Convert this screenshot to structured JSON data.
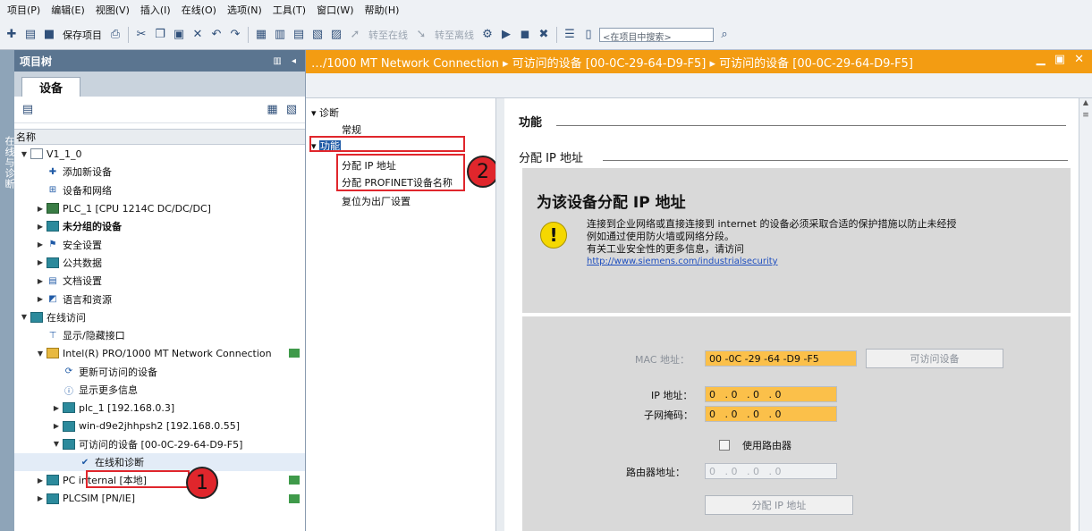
{
  "menu": [
    "项目(P)",
    "编辑(E)",
    "视图(V)",
    "插入(I)",
    "在线(O)",
    "选项(N)",
    "工具(T)",
    "窗口(W)",
    "帮助(H)"
  ],
  "toolbar": {
    "save_label": "保存项目",
    "go_online": "转至在线",
    "go_offline": "转至离线",
    "search_placeholder": "<在项目中搜索>"
  },
  "side_strip_label": "在线与诊断",
  "tree": {
    "title": "项目树",
    "tab": "设备",
    "column_header": "名称",
    "items": [
      {
        "label": "V1_1_0",
        "indent": 0,
        "arrow": "down",
        "icon": "page"
      },
      {
        "label": "添加新设备",
        "indent": 1,
        "arrow": "",
        "icon": "add-device"
      },
      {
        "label": "设备和网络",
        "indent": 1,
        "arrow": "",
        "icon": "network"
      },
      {
        "label": "PLC_1 [CPU 1214C DC/DC/DC]",
        "indent": 1,
        "arrow": "right",
        "icon": "plc"
      },
      {
        "label": "未分组的设备",
        "indent": 1,
        "arrow": "right",
        "icon": "folder",
        "bold": true
      },
      {
        "label": "安全设置",
        "indent": 1,
        "arrow": "right",
        "icon": "security"
      },
      {
        "label": "公共数据",
        "indent": 1,
        "arrow": "right",
        "icon": "folder"
      },
      {
        "label": "文档设置",
        "indent": 1,
        "arrow": "right",
        "icon": "doc"
      },
      {
        "label": "语言和资源",
        "indent": 1,
        "arrow": "right",
        "icon": "language"
      },
      {
        "label": "在线访问",
        "indent": 0,
        "arrow": "down",
        "icon": "folder"
      },
      {
        "label": "显示/隐藏接口",
        "indent": 1,
        "arrow": "",
        "icon": "filter"
      },
      {
        "label": "Intel(R) PRO/1000 MT Network Connection",
        "indent": 1,
        "arrow": "down",
        "icon": "net"
      },
      {
        "label": "更新可访问的设备",
        "indent": 2,
        "arrow": "",
        "icon": "update"
      },
      {
        "label": "显示更多信息",
        "indent": 2,
        "arrow": "",
        "icon": "info"
      },
      {
        "label": "plc_1 [192.168.0.3]",
        "indent": 2,
        "arrow": "right",
        "icon": "folder"
      },
      {
        "label": "win-d9e2jhhpsh2 [192.168.0.55]",
        "indent": 2,
        "arrow": "right",
        "icon": "folder"
      },
      {
        "label": "可访问的设备 [00-0C-29-64-D9-F5]",
        "indent": 2,
        "arrow": "down",
        "icon": "folder"
      },
      {
        "label": "在线和诊断",
        "indent": 3,
        "arrow": "",
        "icon": "diag"
      },
      {
        "label": "PC internal [本地]",
        "indent": 1,
        "arrow": "right",
        "icon": "folder"
      },
      {
        "label": "PLCSIM [PN/IE]",
        "indent": 1,
        "arrow": "right",
        "icon": "folder"
      }
    ]
  },
  "breadcrumb": "…/1000 MT Network Connection  ▸  可访问的设备 [00-0C-29-64-D9-F5]  ▸  可访问的设备 [00-0C-29-64-D9-F5]",
  "nav": {
    "diagnostics": "诊断",
    "general": "常规",
    "functions": "功能",
    "assign_ip": "分配 IP 地址",
    "assign_name": "分配 PROFINET设备名称",
    "reset": "复位为出厂设置"
  },
  "annotations": {
    "one": "1",
    "two": "2"
  },
  "content": {
    "section_functions": "功能",
    "section_assign_ip": "分配 IP 地址",
    "box_title": "为该设备分配 IP 地址",
    "warning_line1": "连接到企业网络或直接连接到 internet 的设备必须采取合适的保护措施以防止未经授",
    "warning_line2": "例如通过使用防火墙或网络分段。",
    "warning_line3": "有关工业安全性的更多信息，请访问",
    "warning_link": "http://www.siemens.com/industrialsecurity",
    "mac_label": "MAC 地址：",
    "mac_value": "00 -0C -29 -64 -D9 -F5",
    "accessible_button": "可访问设备",
    "ip_label": "IP 地址：",
    "ip_value": "0   . 0   . 0   . 0",
    "subnet_label": "子网掩码：",
    "subnet_value": "0   . 0   . 0   . 0",
    "use_router": "使用路由器",
    "router_label": "路由器地址：",
    "router_value": "0   . 0   . 0   . 0",
    "assign_button": "分配 IP 地址"
  },
  "colors": {
    "accent_orange": "#f39c12",
    "field_orange": "#fbc04a",
    "annotation_red": "#e0262c",
    "tree_header": "#5b7590"
  }
}
